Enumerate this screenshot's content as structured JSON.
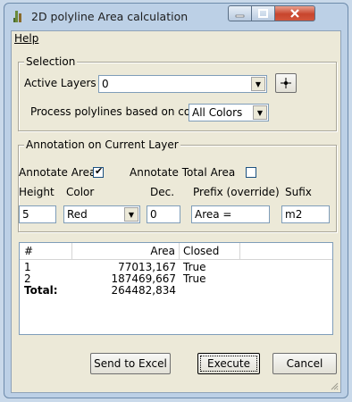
{
  "window": {
    "title": "2D polyline Area calculation"
  },
  "menu": {
    "help": "Help"
  },
  "selection": {
    "legend": "Selection",
    "active_layers_label": "Active Layers",
    "active_layers_value": "0",
    "process_label": "Process polylines based on color",
    "color_filter_value": "All Colors"
  },
  "annotation": {
    "legend": "Annotation on Current Layer",
    "annotate_area_label": "Annotate Area",
    "annotate_area_checked": true,
    "annotate_total_label": "Annotate Total Area",
    "annotate_total_checked": false,
    "height_label": "Height",
    "color_label": "Color",
    "dec_label": "Dec.",
    "prefix_label": "Prefix (override)",
    "suffix_label": "Sufix",
    "height_value": "5",
    "color_value": "Red",
    "dec_value": "0",
    "prefix_value": "Area =",
    "suffix_value": "m2"
  },
  "results": {
    "columns": [
      "#",
      "Area",
      "Closed"
    ],
    "rows": [
      {
        "num": "1",
        "area": "77013,167",
        "closed": "True"
      },
      {
        "num": "2",
        "area": "187469,667",
        "closed": "True"
      }
    ],
    "total_label": "Total:",
    "total_value": "264482,834"
  },
  "buttons": {
    "send_to_excel": "Send to Excel",
    "execute": "Execute",
    "cancel": "Cancel"
  }
}
